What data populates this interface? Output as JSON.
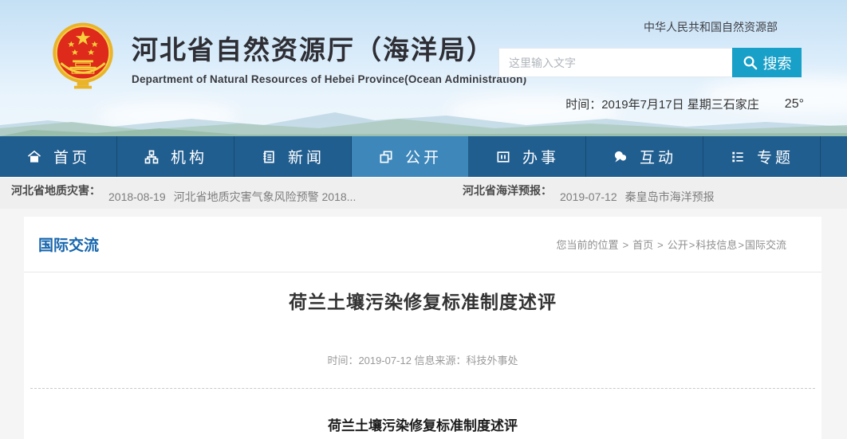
{
  "header": {
    "title": "河北省自然资源厅（海洋局）",
    "subtitle": "Department of Natural Resources of Hebei Province(Ocean  Administration)",
    "gov_link": "中华人民共和国自然资源部",
    "time_text": "时间：2019年7月17日 星期三",
    "city": "石家庄",
    "temperature": "25°"
  },
  "search": {
    "placeholder": "这里输入文字",
    "button_label": "搜索",
    "button_color": "#18a0c8"
  },
  "nav": {
    "bg_color": "#215e90",
    "active_color": "#3e87bb",
    "items": [
      {
        "label": "首页",
        "icon": "home-icon",
        "active": false
      },
      {
        "label": "机构",
        "icon": "org-icon",
        "active": false
      },
      {
        "label": "新闻",
        "icon": "news-icon",
        "active": false
      },
      {
        "label": "公开",
        "icon": "disclosure-icon",
        "active": true
      },
      {
        "label": "办事",
        "icon": "service-icon",
        "active": false
      },
      {
        "label": "互动",
        "icon": "interact-icon",
        "active": false
      },
      {
        "label": "专题",
        "icon": "topics-icon",
        "active": false
      }
    ]
  },
  "ticker": {
    "groups": [
      {
        "label": "河北省地质灾害：",
        "date": "2018-08-19",
        "text": "河北省地质灾害气象风险预警 2018..."
      },
      {
        "label": "河北省海洋预报：",
        "date": "2019-07-12",
        "text": "秦皇岛市海洋预报"
      }
    ]
  },
  "content": {
    "section_title": "国际交流",
    "breadcrumb": {
      "label": "您当前的位置",
      "sep": ">",
      "home": "首页",
      "open": "公开",
      "sci": "科技信息",
      "intl": "国际交流"
    },
    "article": {
      "title": "荷兰土壤污染修复标准制度述评",
      "meta": "时间：2019-07-12 信息来源：科技外事处",
      "body_heading": "荷兰土壤污染修复标准制度述评"
    }
  },
  "colors": {
    "header_sky": "#cfe6f7",
    "section_blue": "#1565ad",
    "ticker_bg": "#efefef"
  }
}
